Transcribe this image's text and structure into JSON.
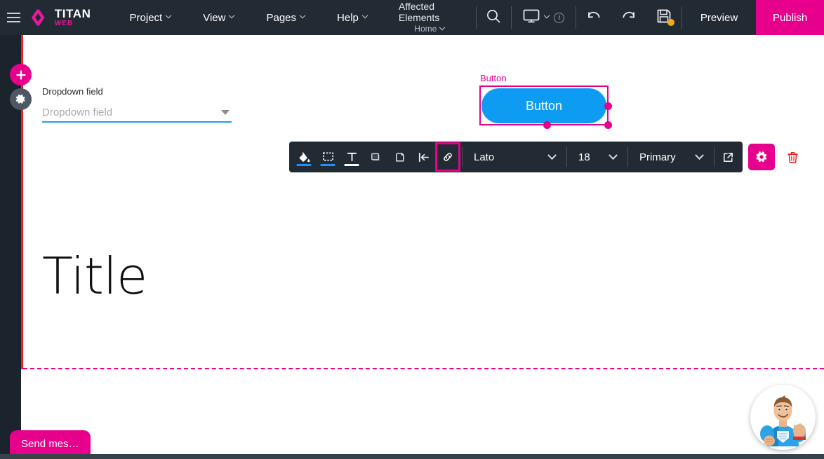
{
  "header": {
    "menu_icon": "hamburger-icon",
    "brand": {
      "title": "TITAN",
      "subtitle": "WEB",
      "logo_icon": "titan-diamond-logo"
    },
    "menus": [
      {
        "label": "Project",
        "icon": "chevron-down-icon"
      },
      {
        "label": "View",
        "icon": "chevron-down-icon"
      },
      {
        "label": "Pages",
        "icon": "chevron-down-icon"
      },
      {
        "label": "Help",
        "icon": "chevron-down-icon"
      }
    ],
    "affected": {
      "title": "Affected Elements",
      "page": "Home",
      "icon": "chevron-down-icon"
    },
    "search_icon": "search-icon",
    "device_icon": "desktop-monitor-icon",
    "device_chevron": "chevron-down-icon",
    "info_badge": "i",
    "undo_icon": "undo-arrow-icon",
    "redo_icon": "redo-arrow-icon",
    "save_icon": "floppy-disk-save-icon",
    "save_badge_color": "#f5a623",
    "preview_label": "Preview",
    "publish_label": "Publish",
    "publish_color": "#e6008c",
    "background_color": "#222b33"
  },
  "sidebar": {
    "add_label": "+",
    "add_color": "#e6008c",
    "gear_icon": "gear-icon",
    "gear_color": "#4c5863",
    "guide_line_color": "#f41f1f"
  },
  "canvas": {
    "dropdown": {
      "label": "Dropdown field",
      "placeholder": "Dropdown field",
      "caret_icon": "dropdown-caret-icon",
      "underline_color": "#1e9ff2"
    },
    "selected_element": {
      "tag": "Button",
      "button_label": "Button",
      "button_color": "#0e9bf2",
      "selection_color": "#e6008c",
      "handles": [
        "right-middle",
        "bottom-center",
        "bottom-right"
      ]
    },
    "title": "Title",
    "section_divider_color": "#e6008c"
  },
  "toolbar": {
    "icons": [
      {
        "name": "fill-color-icon",
        "underline": "#1e90ff"
      },
      {
        "name": "border-color-icon",
        "underline": "#1e90ff"
      },
      {
        "name": "text-color-icon",
        "underline": "#ffffff"
      },
      {
        "name": "shadow-icon",
        "underline": null
      },
      {
        "name": "corner-radius-icon",
        "underline": null
      },
      {
        "name": "align-left-icon",
        "underline": null
      }
    ],
    "link_icon": "link-chain-icon",
    "link_highlight_color": "#e6008c",
    "font_family": "Lato",
    "font_size": "18",
    "color_preset": "Primary",
    "chevron_icon": "chevron-down-icon",
    "external_link_icon": "external-link-icon",
    "settings_icon": "gear-icon",
    "settings_color": "#e6008c",
    "delete_icon": "trash-icon",
    "delete_color": "#e01b1b"
  },
  "chat": {
    "send_message_label": "Send mes…",
    "send_message_color": "#e6008c",
    "avatar_icon": "support-hero-avatar"
  }
}
